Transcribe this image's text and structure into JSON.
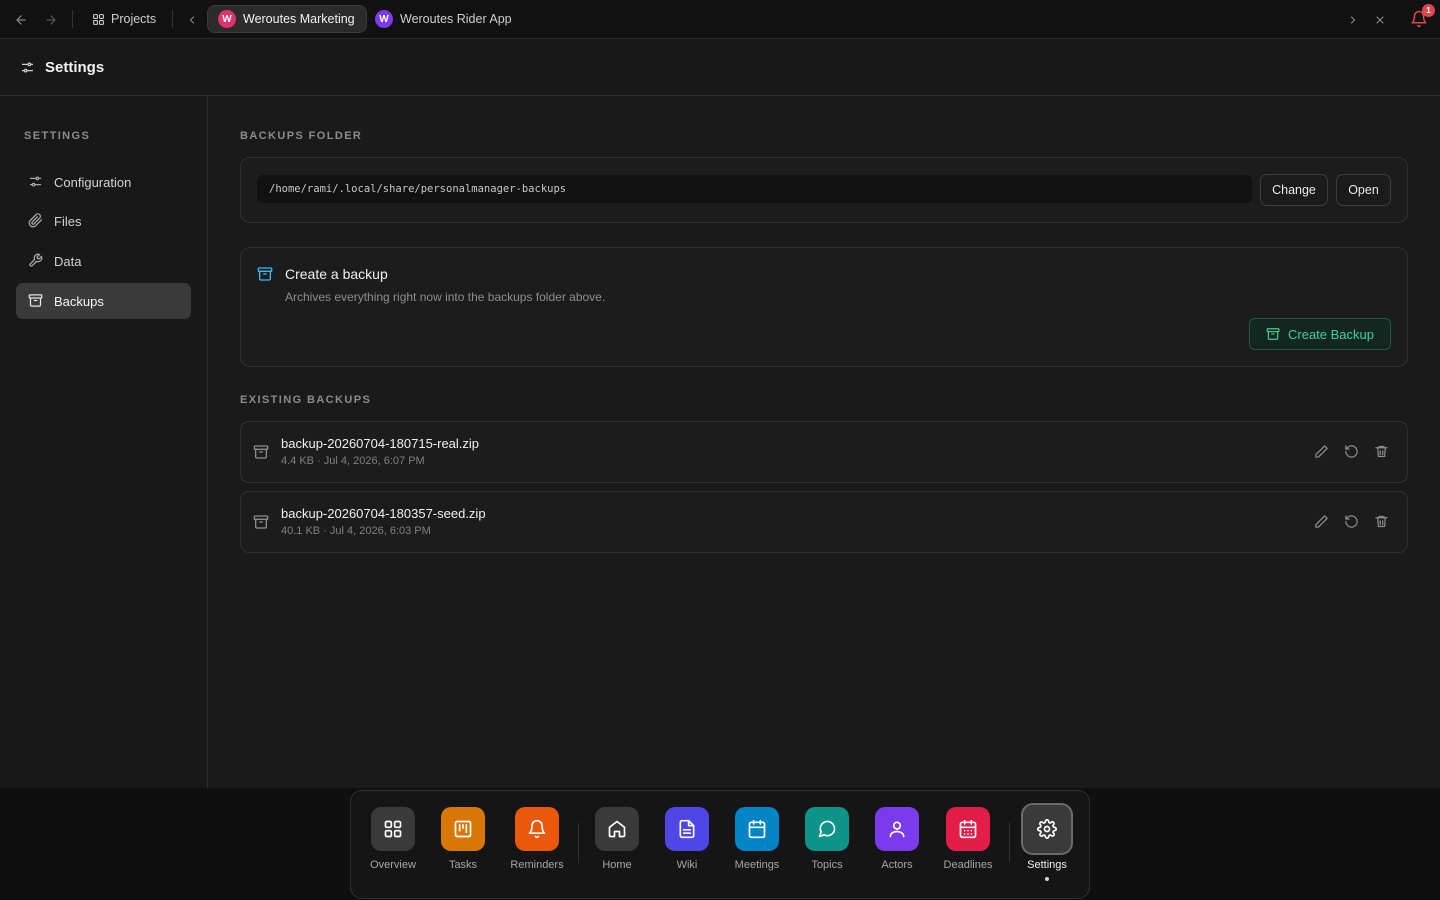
{
  "topbar": {
    "projects_label": "Projects",
    "tabs": [
      {
        "avatar": "W",
        "label": "Weroutes Marketing",
        "color": "#e0306e",
        "active": true
      },
      {
        "avatar": "W",
        "label": "Weroutes Rider App",
        "color": "#7c3aed",
        "active": false
      }
    ],
    "notification_count": "1"
  },
  "header": {
    "title": "Settings"
  },
  "sidebar": {
    "heading": "SETTINGS",
    "items": [
      {
        "label": "Configuration",
        "icon": "sliders-icon"
      },
      {
        "label": "Files",
        "icon": "paperclip-icon"
      },
      {
        "label": "Data",
        "icon": "wrench-icon"
      },
      {
        "label": "Backups",
        "icon": "archive-icon",
        "active": true
      }
    ]
  },
  "main": {
    "folder_heading": "BACKUPS FOLDER",
    "folder_path": "/home/rami/.local/share/personalmanager-backups",
    "change_label": "Change",
    "open_label": "Open",
    "create": {
      "title": "Create a backup",
      "description": "Archives everything right now into the backups folder above.",
      "button_label": "Create Backup"
    },
    "existing_heading": "EXISTING BACKUPS",
    "backups": [
      {
        "name": "backup-20260704-180715-real.zip",
        "meta": "4.4 KB · Jul 4, 2026, 6:07 PM"
      },
      {
        "name": "backup-20260704-180357-seed.zip",
        "meta": "40.1 KB · Jul 4, 2026, 6:03 PM"
      }
    ]
  },
  "dock": {
    "items": [
      {
        "label": "Overview",
        "icon": "grid-icon",
        "color": "#3a3a3a"
      },
      {
        "label": "Tasks",
        "icon": "kanban-icon",
        "color": "#d97706"
      },
      {
        "label": "Reminders",
        "icon": "bell-icon",
        "color": "#ea580c"
      },
      {
        "label": "Home",
        "icon": "home-icon",
        "color": "#3a3a3a"
      },
      {
        "label": "Wiki",
        "icon": "document-icon",
        "color": "#4f46e5"
      },
      {
        "label": "Meetings",
        "icon": "calendar-icon",
        "color": "#0284c7"
      },
      {
        "label": "Topics",
        "icon": "chat-icon",
        "color": "#0d9488"
      },
      {
        "label": "Actors",
        "icon": "user-icon",
        "color": "#7c3aed"
      },
      {
        "label": "Deadlines",
        "icon": "calendar-grid-icon",
        "color": "#e11d48"
      },
      {
        "label": "Settings",
        "icon": "gear-icon",
        "color": "#3a3a3a",
        "active": true
      }
    ]
  },
  "colors": {
    "accent_green": "#3fd09a",
    "notification_red": "#e0464e",
    "create_icon_blue": "#38bdf8"
  }
}
